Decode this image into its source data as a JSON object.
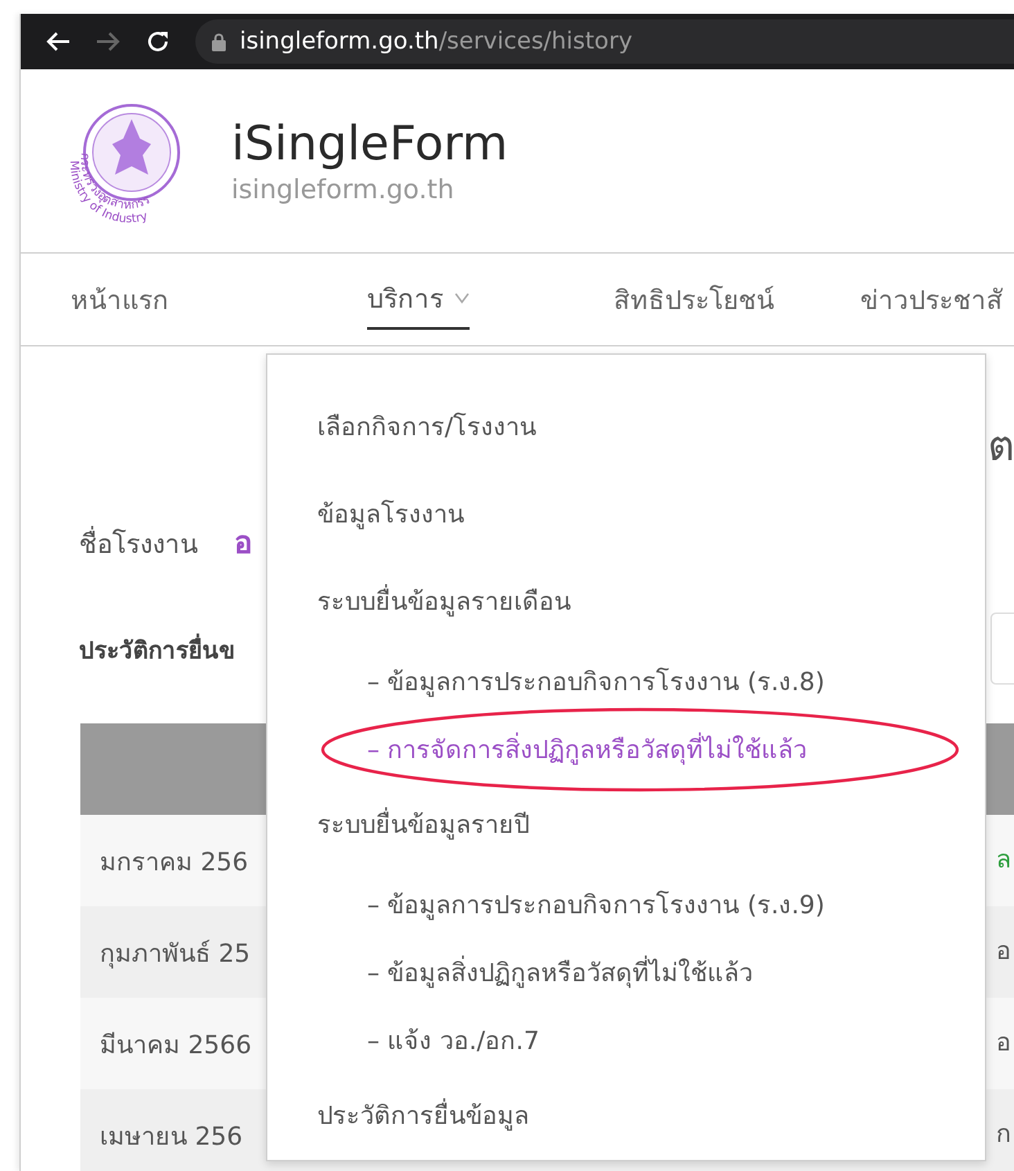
{
  "browser": {
    "url_host": "isingleform.go.th",
    "url_path": "/services/history",
    "forward_disabled": true
  },
  "header": {
    "logo": {
      "text_th": "กระทรวงอุตสาหกรรม",
      "text_en": "Ministry of Industry"
    },
    "title": "iSingleForm",
    "subtitle": "isingleform.go.th"
  },
  "nav": [
    {
      "label": "หน้าแรก",
      "selected": false,
      "dropdown": false
    },
    {
      "label": "บริการ",
      "selected": true,
      "dropdown": true
    },
    {
      "label": "สิทธิประโยชน์",
      "selected": false,
      "dropdown": false
    },
    {
      "label": "ข่าวประชาสั",
      "selected": false,
      "dropdown": false
    }
  ],
  "page": {
    "heading_fragment": "ต",
    "factory_label": "ชื่อโรงงาน",
    "factory_value": "อ",
    "history_label": "ประวัติการยื่นข"
  },
  "table": {
    "rows": [
      {
        "month": "มกราคม 256",
        "column_2": "ล",
        "color": "#2e9e3e"
      },
      {
        "month": "กุมภาพันธ์ 25",
        "column_2": "อ",
        "color": "#555555"
      },
      {
        "month": "มีนาคม 2566",
        "column_2": "อ",
        "color": "#555555"
      },
      {
        "month": "เมษายน 256",
        "column_2": "ก",
        "color": "#555555"
      }
    ]
  },
  "dropdown_menu": [
    {
      "kind": "item",
      "label": "เลือกกิจการ/โรงงาน",
      "selected": false,
      "circled": false
    },
    {
      "kind": "item",
      "label": "ข้อมูลโรงงาน",
      "selected": false,
      "circled": false
    },
    {
      "kind": "section",
      "label": "ระบบยื่นข้อมูลรายเดือน",
      "selected": false,
      "circled": false
    },
    {
      "kind": "sub",
      "label": "– ข้อมูลการประกอบกิจการโรงงาน (ร.ง.8)",
      "selected": false,
      "circled": false
    },
    {
      "kind": "sub",
      "label": "– การจัดการสิ่งปฏิกูลหรือวัสดุที่ไม่ใช้แล้ว",
      "selected": true,
      "circled": true
    },
    {
      "kind": "section",
      "label": "ระบบยื่นข้อมูลรายปี",
      "selected": false,
      "circled": false
    },
    {
      "kind": "sub",
      "label": "– ข้อมูลการประกอบกิจการโรงงาน (ร.ง.9)",
      "selected": false,
      "circled": false
    },
    {
      "kind": "sub",
      "label": "– ข้อมูลสิ่งปฏิกูลหรือวัสดุที่ไม่ใช้แล้ว",
      "selected": false,
      "circled": false
    },
    {
      "kind": "sub",
      "label": "– แจ้ง วอ./อก.7",
      "selected": false,
      "circled": false
    },
    {
      "kind": "item",
      "label": "ประวัติการยื่นข้อมูล",
      "selected": false,
      "circled": false
    }
  ]
}
